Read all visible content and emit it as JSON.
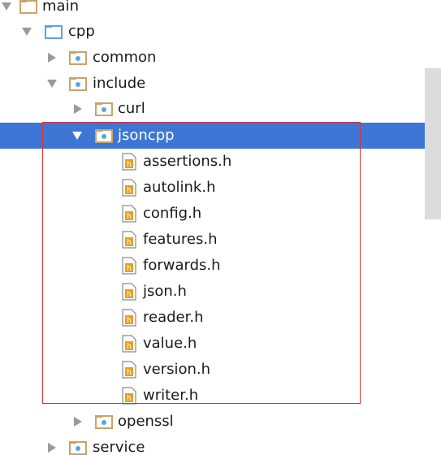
{
  "tree": {
    "items": [
      {
        "label": "main",
        "kind": "folder",
        "expanded": true,
        "selected": false
      },
      {
        "label": "cpp",
        "kind": "source-folder",
        "expanded": true,
        "selected": false
      },
      {
        "label": "common",
        "kind": "package-folder",
        "expanded": false,
        "selected": false
      },
      {
        "label": "include",
        "kind": "package-folder",
        "expanded": true,
        "selected": false
      },
      {
        "label": "curl",
        "kind": "package-folder",
        "expanded": false,
        "selected": false
      },
      {
        "label": "jsoncpp",
        "kind": "package-folder",
        "expanded": true,
        "selected": true
      },
      {
        "label": "assertions.h",
        "kind": "header-file"
      },
      {
        "label": "autolink.h",
        "kind": "header-file"
      },
      {
        "label": "config.h",
        "kind": "header-file"
      },
      {
        "label": "features.h",
        "kind": "header-file"
      },
      {
        "label": "forwards.h",
        "kind": "header-file"
      },
      {
        "label": "json.h",
        "kind": "header-file"
      },
      {
        "label": "reader.h",
        "kind": "header-file"
      },
      {
        "label": "value.h",
        "kind": "header-file"
      },
      {
        "label": "version.h",
        "kind": "header-file"
      },
      {
        "label": "writer.h",
        "kind": "header-file"
      },
      {
        "label": "openssl",
        "kind": "package-folder",
        "expanded": false,
        "selected": false
      },
      {
        "label": "service",
        "kind": "package-folder",
        "expanded": false,
        "selected": false
      }
    ]
  },
  "colors": {
    "selection": "#3d76d4",
    "highlight_border": "#e0302f",
    "folder": "#c8a46a",
    "source_folder": "#5aa7d6",
    "header_file_badge": "#e8a21e",
    "arrow": "#9a9a9a"
  },
  "icons": {
    "folder": "folder-icon",
    "source-folder": "source-folder-icon",
    "package-folder": "package-folder-icon",
    "header-file": "header-file-icon",
    "expanded": "triangle-down-icon",
    "collapsed": "triangle-right-icon"
  }
}
